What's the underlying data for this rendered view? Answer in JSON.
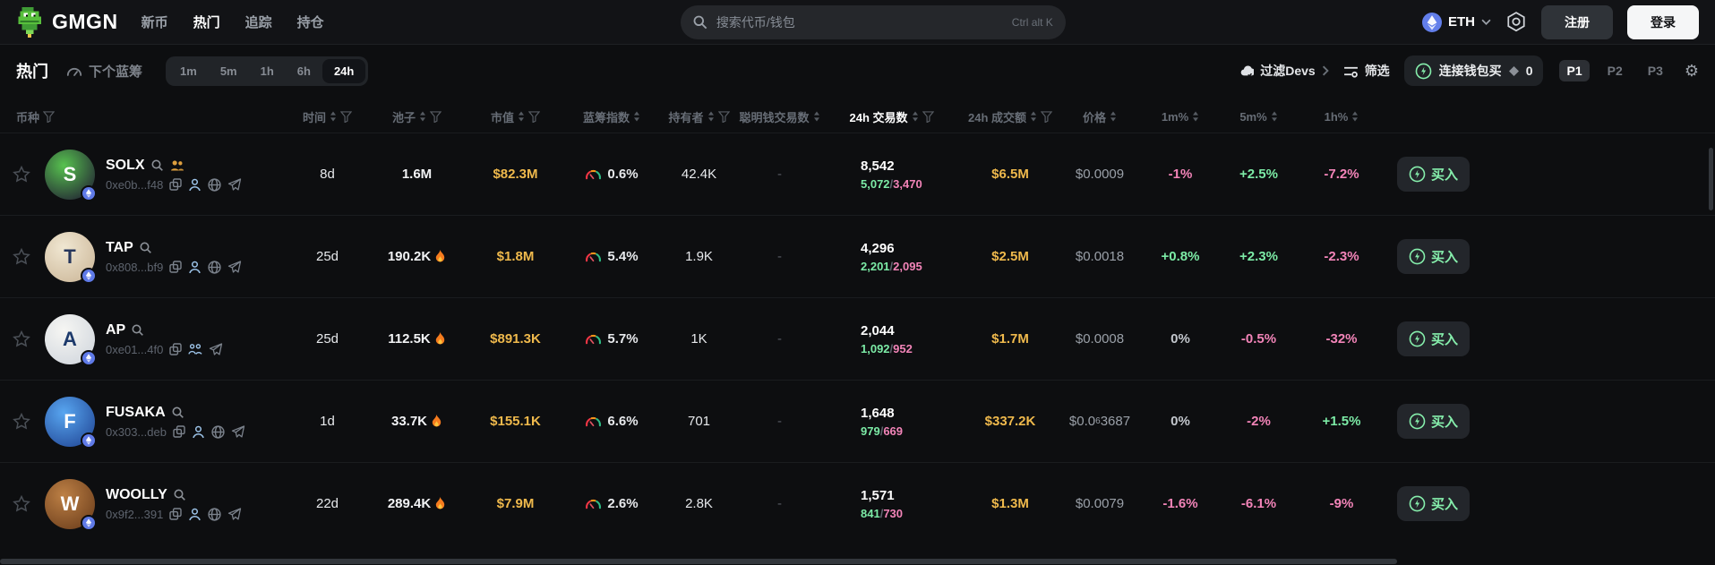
{
  "header": {
    "logo_text": "GMGN",
    "nav": [
      {
        "label": "新币",
        "active": false
      },
      {
        "label": "热门",
        "active": true
      },
      {
        "label": "追踪",
        "active": false
      },
      {
        "label": "持仓",
        "active": false
      }
    ],
    "search": {
      "placeholder": "搜索代币/钱包",
      "shortcut": "Ctrl alt K"
    },
    "chain": "ETH",
    "register_label": "注册",
    "login_label": "登录"
  },
  "toolbar": {
    "title": "热门",
    "next_bluechip_label": "下个蓝筹",
    "timeframes": [
      "1m",
      "5m",
      "1h",
      "6h",
      "24h"
    ],
    "active_timeframe": "24h",
    "filter_devs_label": "过滤Devs",
    "filter_label": "筛选",
    "connect_wallet_label": "连接钱包买",
    "wallet_count": "0",
    "presets": [
      "P1",
      "P2",
      "P3"
    ],
    "active_preset": "P1"
  },
  "table": {
    "buy_label": "买入",
    "columns": [
      {
        "key": "symbol",
        "label": "币种",
        "sort": false,
        "filter": true,
        "active": false
      },
      {
        "key": "age",
        "label": "时间",
        "sort": true,
        "filter": true,
        "active": false
      },
      {
        "key": "pool",
        "label": "池子",
        "sort": true,
        "filter": true,
        "active": false
      },
      {
        "key": "mcap",
        "label": "市值",
        "sort": true,
        "filter": true,
        "active": false
      },
      {
        "key": "bluechip",
        "label": "蓝筹指数",
        "sort": true,
        "filter": false,
        "active": false
      },
      {
        "key": "holders",
        "label": "持有者",
        "sort": true,
        "filter": true,
        "active": false
      },
      {
        "key": "smart",
        "label": "聪明钱交易数",
        "sort": true,
        "filter": false,
        "active": false
      },
      {
        "key": "txs",
        "label": "24h 交易数",
        "sort": true,
        "filter": true,
        "active": true
      },
      {
        "key": "volume",
        "label": "24h 成交额",
        "sort": true,
        "filter": true,
        "active": false
      },
      {
        "key": "price",
        "label": "价格",
        "sort": true,
        "filter": false,
        "active": false
      },
      {
        "key": "m1",
        "label": "1m%",
        "sort": true,
        "filter": false,
        "active": false
      },
      {
        "key": "m5",
        "label": "5m%",
        "sort": true,
        "filter": false,
        "active": false
      },
      {
        "key": "h1",
        "label": "1h%",
        "sort": true,
        "filter": false,
        "active": false
      }
    ],
    "rows": [
      {
        "symbol": "SOLX",
        "address": "0xe0b...f48",
        "age": "8d",
        "pool": "1.6M",
        "pool_fire": false,
        "mcap": "$82.3M",
        "bluechip": "0.6%",
        "holders": "42.4K",
        "smart": "-",
        "txs_total": "8,542",
        "txs_buys": "5,072",
        "txs_sells": "3,470",
        "volume": "$6.5M",
        "price_prefix": "$0.0009",
        "price_sub": "",
        "price_rest": "",
        "change_1m": "-1%",
        "change_5m": "+2.5%",
        "change_1h": "-7.2%",
        "links": [
          "copy",
          "person",
          "globe",
          "telegram"
        ],
        "people_badge": true,
        "avatar_letter": "S",
        "avatar_colors": [
          "#57c24f",
          "#1c1030"
        ],
        "avatar_fg": "#ffffff"
      },
      {
        "symbol": "TAP",
        "address": "0x808...bf9",
        "age": "25d",
        "pool": "190.2K",
        "pool_fire": true,
        "mcap": "$1.8M",
        "bluechip": "5.4%",
        "holders": "1.9K",
        "smart": "-",
        "txs_total": "4,296",
        "txs_buys": "2,201",
        "txs_sells": "2,095",
        "volume": "$2.5M",
        "price_prefix": "$0.0018",
        "price_sub": "",
        "price_rest": "",
        "change_1m": "+0.8%",
        "change_5m": "+2.3%",
        "change_1h": "-2.3%",
        "links": [
          "copy",
          "person",
          "globe",
          "telegram"
        ],
        "people_badge": false,
        "avatar_letter": "T",
        "avatar_colors": [
          "#f0e7d2",
          "#c9b394"
        ],
        "avatar_fg": "#26365c"
      },
      {
        "symbol": "AP",
        "address": "0xe01...4f0",
        "age": "25d",
        "pool": "112.5K",
        "pool_fire": true,
        "mcap": "$891.3K",
        "bluechip": "5.7%",
        "holders": "1K",
        "smart": "-",
        "txs_total": "2,044",
        "txs_buys": "1,092",
        "txs_sells": "952",
        "volume": "$1.7M",
        "price_prefix": "$0.0008",
        "price_sub": "",
        "price_rest": "",
        "change_1m": "0%",
        "change_5m": "-0.5%",
        "change_1h": "-32%",
        "links": [
          "copy",
          "community",
          "telegram"
        ],
        "people_badge": false,
        "avatar_letter": "A",
        "avatar_colors": [
          "#f6f6f3",
          "#cdd3db"
        ],
        "avatar_fg": "#1d3a6b"
      },
      {
        "symbol": "FUSAKA",
        "address": "0x303...deb",
        "age": "1d",
        "pool": "33.7K",
        "pool_fire": true,
        "mcap": "$155.1K",
        "bluechip": "6.6%",
        "holders": "701",
        "smart": "-",
        "txs_total": "1,648",
        "txs_buys": "979",
        "txs_sells": "669",
        "volume": "$337.2K",
        "price_prefix": "$0.0",
        "price_sub": "6",
        "price_rest": "3687",
        "change_1m": "0%",
        "change_5m": "-2%",
        "change_1h": "+1.5%",
        "links": [
          "copy",
          "person",
          "globe",
          "telegram"
        ],
        "people_badge": false,
        "avatar_letter": "F",
        "avatar_colors": [
          "#58a6f0",
          "#1d3f8f"
        ],
        "avatar_fg": "#ffffff"
      },
      {
        "symbol": "WOOLLY",
        "address": "0x9f2...391",
        "age": "22d",
        "pool": "289.4K",
        "pool_fire": true,
        "mcap": "$7.9M",
        "bluechip": "2.6%",
        "holders": "2.8K",
        "smart": "-",
        "txs_total": "1,571",
        "txs_buys": "841",
        "txs_sells": "730",
        "volume": "$1.3M",
        "price_prefix": "$0.0079",
        "price_sub": "",
        "price_rest": "",
        "change_1m": "-1.6%",
        "change_5m": "-6.1%",
        "change_1h": "-9%",
        "links": [
          "copy",
          "person",
          "globe",
          "telegram"
        ],
        "people_badge": false,
        "avatar_letter": "W",
        "avatar_colors": [
          "#bd8045",
          "#653818"
        ],
        "avatar_fg": "#ffffff"
      }
    ]
  },
  "colors": {
    "positive": "#7ceba6",
    "negative": "#f284b8",
    "yellow": "#efb94c",
    "chain_blue": "#627eea",
    "buy_green": "#86efac"
  }
}
